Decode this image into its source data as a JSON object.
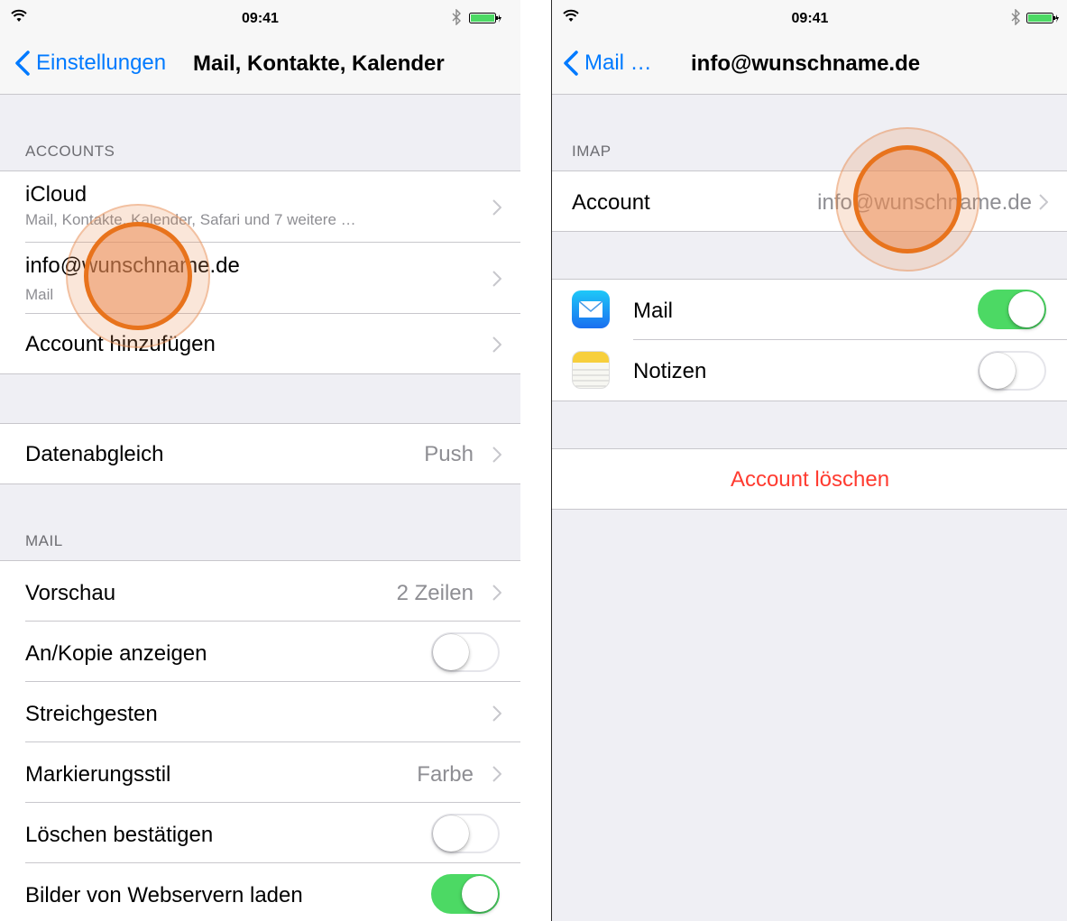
{
  "status": {
    "time": "09:41"
  },
  "left": {
    "back_label": "Einstellungen",
    "title": "Mail, Kontakte, Kalender",
    "accounts_header": "ACCOUNTS",
    "accounts": [
      {
        "title": "iCloud",
        "subtitle": "Mail, Kontakte, Kalender, Safari und 7 weitere …"
      },
      {
        "title": "info@wunschname.de",
        "subtitle": "Mail"
      },
      {
        "title": "Account hinzufügen"
      }
    ],
    "fetch": {
      "label": "Datenabgleich",
      "value": "Push"
    },
    "mail_header": "MAIL",
    "mail_settings": [
      {
        "label": "Vorschau",
        "value": "2 Zeilen"
      },
      {
        "label": "An/Kopie anzeigen",
        "toggle": false
      },
      {
        "label": "Streichgesten"
      },
      {
        "label": "Markierungsstil",
        "value": "Farbe"
      },
      {
        "label": "Löschen bestätigen",
        "toggle": false
      },
      {
        "label": "Bilder von Webservern laden",
        "toggle": true
      }
    ]
  },
  "right": {
    "back_label": "Mail …",
    "title": "info@wunschname.de",
    "imap_header": "IMAP",
    "account": {
      "label": "Account",
      "value": "info@wunschname.de"
    },
    "services": [
      {
        "label": "Mail",
        "icon": "mail-app-icon",
        "toggle": true
      },
      {
        "label": "Notizen",
        "icon": "notes-app-icon",
        "toggle": false
      }
    ],
    "delete_label": "Account löschen"
  },
  "colors": {
    "tint": "#007aff",
    "toggle_on": "#4cd964",
    "destructive": "#ff3b30",
    "tap_indicator": "#e8731c"
  }
}
